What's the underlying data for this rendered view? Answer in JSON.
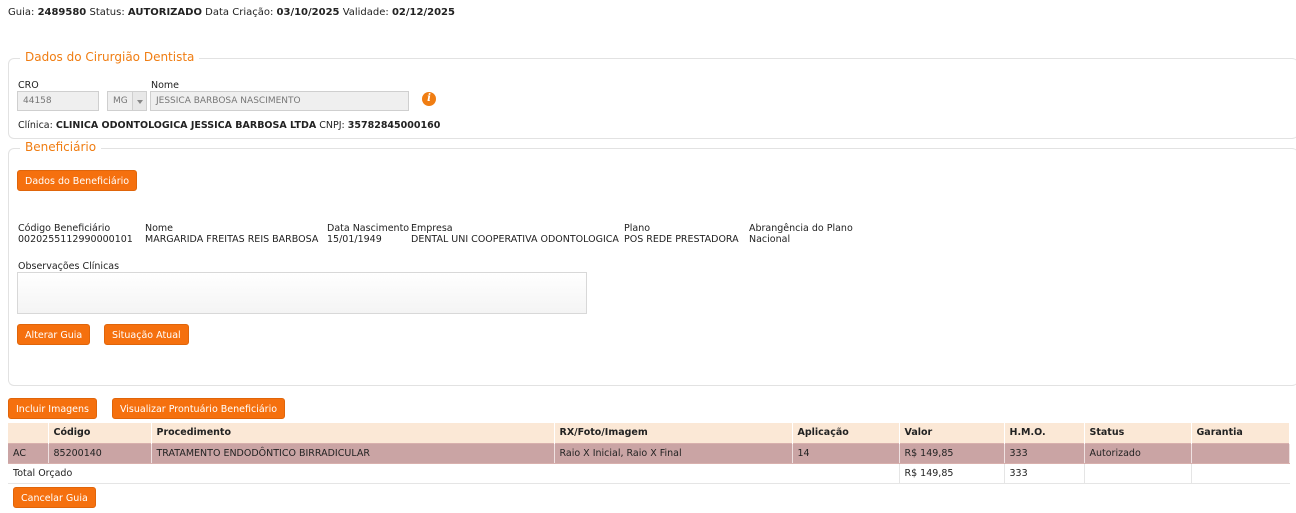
{
  "header": {
    "guia_label": "Guia:",
    "guia_value": "2489580",
    "status_label": "Status:",
    "status_value": "AUTORIZADO",
    "data_criacao_label": "Data Criação:",
    "data_criacao_value": "03/10/2025",
    "validade_label": "Validade:",
    "validade_value": "02/12/2025"
  },
  "dentista": {
    "legend": "Dados do Cirurgião Dentista",
    "cro_label": "CRO",
    "cro_value": "44158",
    "uf_value": "MG",
    "nome_label": "Nome",
    "nome_value": "JESSICA BARBOSA NASCIMENTO",
    "clinica_label": "Clínica:",
    "clinica_value": "CLINICA ODONTOLOGICA JESSICA BARBOSA LTDA",
    "cnpj_label": "CNPJ:",
    "cnpj_value": "35782845000160",
    "info_icon": "info-icon"
  },
  "beneficiario": {
    "legend": "Beneficiário",
    "dados_button": "Dados do Beneficiário",
    "fields": [
      {
        "label": "Código Beneficiário",
        "value": "0020255112990000101"
      },
      {
        "label": "Nome",
        "value": "MARGARIDA FREITAS REIS BARBOSA"
      },
      {
        "label": "Data Nascimento",
        "value": "15/01/1949"
      },
      {
        "label": "Empresa",
        "value": "DENTAL UNI COOPERATIVA ODONTOLOGICA"
      },
      {
        "label": "Plano",
        "value": "POS REDE PRESTADORA"
      },
      {
        "label": "Abrangência do Plano",
        "value": "Nacional"
      }
    ],
    "obs_label": "Observações Clínicas",
    "obs_value": "",
    "alterar_button": "Alterar Guia",
    "situacao_button": "Situação Atual"
  },
  "actions": {
    "incluir_imagens": "Incluir Imagens",
    "visualizar_prontuario": "Visualizar Prontuário Beneficiário",
    "cancelar_guia": "Cancelar Guia"
  },
  "table": {
    "columns": [
      "",
      "Código",
      "Procedimento",
      "RX/Foto/Imagem",
      "Aplicação",
      "Valor",
      "H.M.O.",
      "Status",
      "Garantia"
    ],
    "rows": [
      [
        "AC",
        "85200140",
        "TRATAMENTO ENDODÔNTICO BIRRADICULAR",
        "Raio X Inicial, Raio X Final",
        "14",
        "R$ 149,85",
        "333",
        "Autorizado",
        ""
      ]
    ],
    "total": {
      "label": "Total Orçado",
      "valor": "R$ 149,85",
      "hmo": "333"
    }
  },
  "colors": {
    "accent": "#f5700e",
    "legend": "#f07d12",
    "header_row": "#fbe8d6",
    "selected_row": "#caa4a4"
  }
}
